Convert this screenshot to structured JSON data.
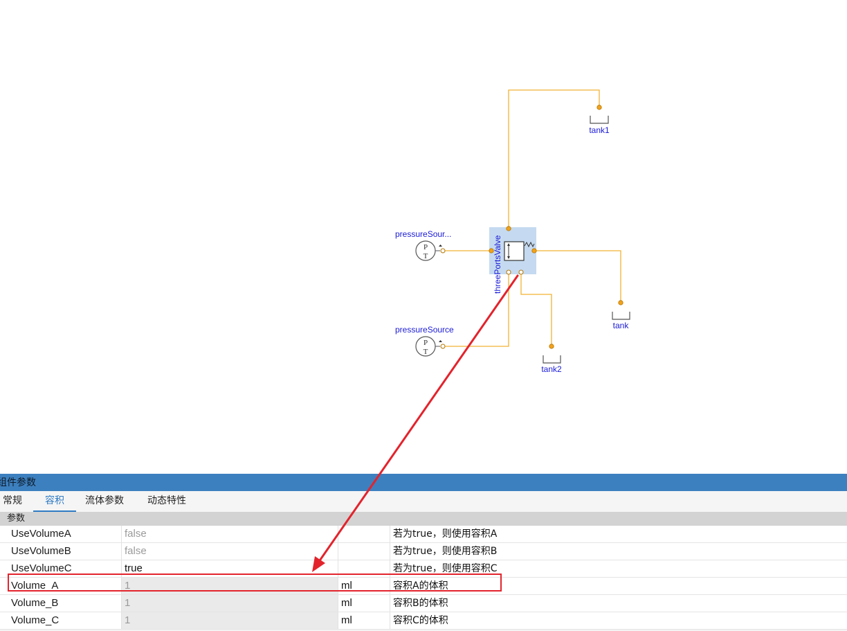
{
  "diagram": {
    "labels": {
      "tank1": "tank1",
      "tank": "tank",
      "tank2": "tank2",
      "pressure_source_top": "pressureSour...",
      "pressure_source_bottom": "pressureSource",
      "valve": "threePortsValve"
    },
    "colors": {
      "wire": "#f2b233",
      "port": "#f2a21b",
      "label": "#1a1ad6",
      "valve_highlight": "#c5daf0",
      "arrow": "#e3232c"
    }
  },
  "panel": {
    "title": "组件参数",
    "tabs": [
      {
        "label": "常规"
      },
      {
        "label": "容积"
      },
      {
        "label": "流体参数"
      },
      {
        "label": "动态特性"
      }
    ],
    "active_tab": "容积",
    "section": "参数",
    "rows": [
      {
        "name": "UseVolumeA",
        "value": "false",
        "unit": "",
        "desc": "若为true，则使用容积A"
      },
      {
        "name": "UseVolumeB",
        "value": "false",
        "unit": "",
        "desc": "若为true，则使用容积B"
      },
      {
        "name": "UseVolumeC",
        "value": "true",
        "unit": "",
        "desc": "若为true，则使用容积C"
      },
      {
        "name": "Volume_A",
        "value": "1",
        "unit": "ml",
        "desc": "容积A的体积"
      },
      {
        "name": "Volume_B",
        "value": "1",
        "unit": "ml",
        "desc": "容积B的体积"
      },
      {
        "name": "Volume_C",
        "value": "1",
        "unit": "ml",
        "desc": "容积C的体积"
      }
    ],
    "colors": {
      "title_bar": "#3d80bf",
      "active_tab": "#2f7bc3",
      "highlight_box": "#e3232c"
    }
  }
}
